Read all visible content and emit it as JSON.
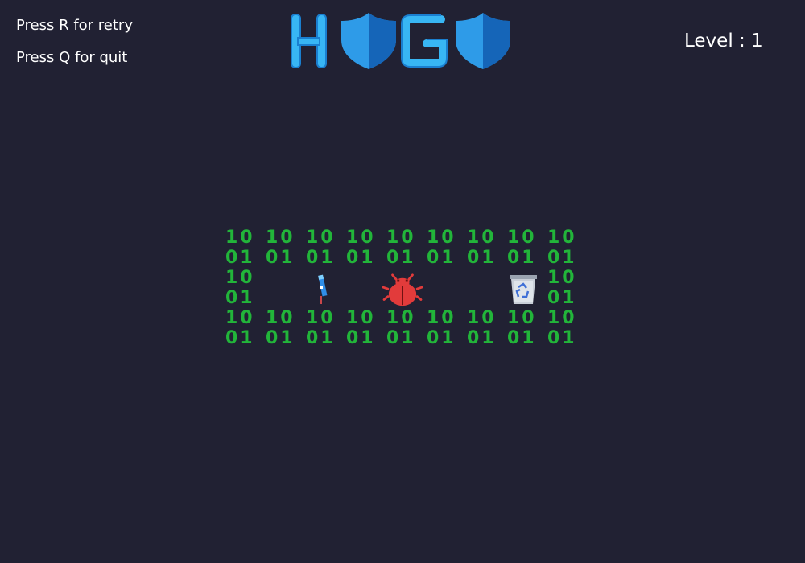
{
  "hints": {
    "retry": "Press R for retry",
    "quit": "Press Q for quit"
  },
  "level_label": "Level : 1",
  "logo": {
    "letters": [
      "H",
      "G"
    ],
    "colors": {
      "letter": "#38b6f4",
      "letter_dark": "#1a7fd0",
      "shield_light": "#2e9be8",
      "shield_dark": "#1565b8"
    }
  },
  "grid": {
    "wall_color": "#22b53a",
    "rows": [
      [
        "10",
        "10",
        "10",
        "10",
        "10",
        "10",
        "10",
        "10",
        "10"
      ],
      [
        "01",
        "01",
        "01",
        "01",
        "01",
        "01",
        "01",
        "01",
        "01"
      ],
      [
        "10",
        "",
        "",
        "",
        "",
        "",
        "",
        "",
        "10"
      ],
      [
        "01",
        "",
        "",
        "",
        "",
        "",
        "",
        "",
        "01"
      ],
      [
        "10",
        "10",
        "10",
        "10",
        "10",
        "10",
        "10",
        "10",
        "10"
      ],
      [
        "01",
        "01",
        "01",
        "01",
        "01",
        "01",
        "01",
        "01",
        "01"
      ]
    ]
  },
  "entities": {
    "player": {
      "name": "player-pencil-icon",
      "color": "#2f8ee8",
      "row": 2,
      "col": 2
    },
    "bug": {
      "name": "bug-enemy-icon",
      "color": "#e23b3b",
      "row": 2,
      "col": 4
    },
    "recycle_bin": {
      "name": "recycle-bin-icon",
      "color": "#c9cfd8",
      "row": 2,
      "col": 7
    }
  }
}
